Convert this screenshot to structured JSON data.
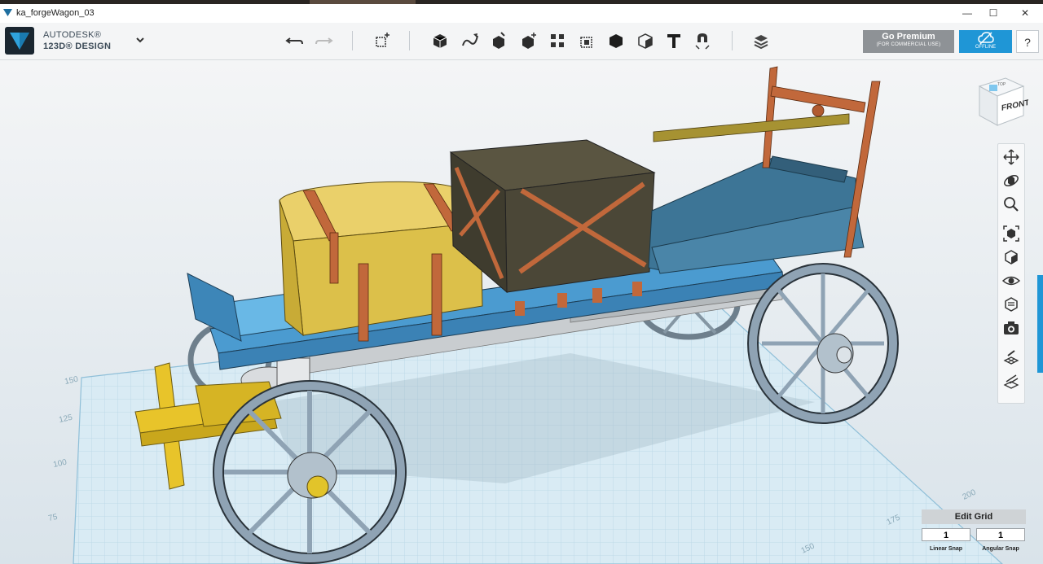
{
  "window": {
    "title": "ka_forgeWagon_03",
    "minimize": "—",
    "maximize": "☐",
    "close": "✕"
  },
  "brand": {
    "line1": "AUTODESK®",
    "line2": "123D® DESIGN"
  },
  "toolbar": {
    "undo_icon": "undo-icon",
    "redo_icon": "redo-icon",
    "tools": [
      "transform-icon",
      "primitives-icon",
      "sketch-icon",
      "construct-icon",
      "modify-icon",
      "pattern-icon",
      "group-icon",
      "combine-icon",
      "measure-icon",
      "text-icon",
      "snap-icon",
      "material-icon"
    ]
  },
  "premium": {
    "title": "Go Premium",
    "subtitle": "(FOR COMMERCIAL USE)"
  },
  "offline": {
    "label": "OFFLINE"
  },
  "help": {
    "label": "?"
  },
  "viewcube": {
    "face_label": "FRONT",
    "top_label": "TOP"
  },
  "grid_labels": {
    "left": [
      "150",
      "125",
      "100",
      "75"
    ],
    "bottom": [
      "200",
      "175",
      "150"
    ]
  },
  "grid_panel": {
    "edit_grid_label": "Edit Grid",
    "linear_snap_value": "1",
    "angular_snap_value": "1",
    "linear_snap_label": "Linear Snap",
    "angular_snap_label": "Angular Snap"
  },
  "colors": {
    "accent": "#1f96d6",
    "premium": "#8e9296",
    "grid_floor": "#d9ebf4",
    "wagon_blue": "#3d86b8",
    "chest_yellow": "#dcc04a",
    "crate_dark": "#4b4737",
    "strap_copper": "#c1683b"
  }
}
